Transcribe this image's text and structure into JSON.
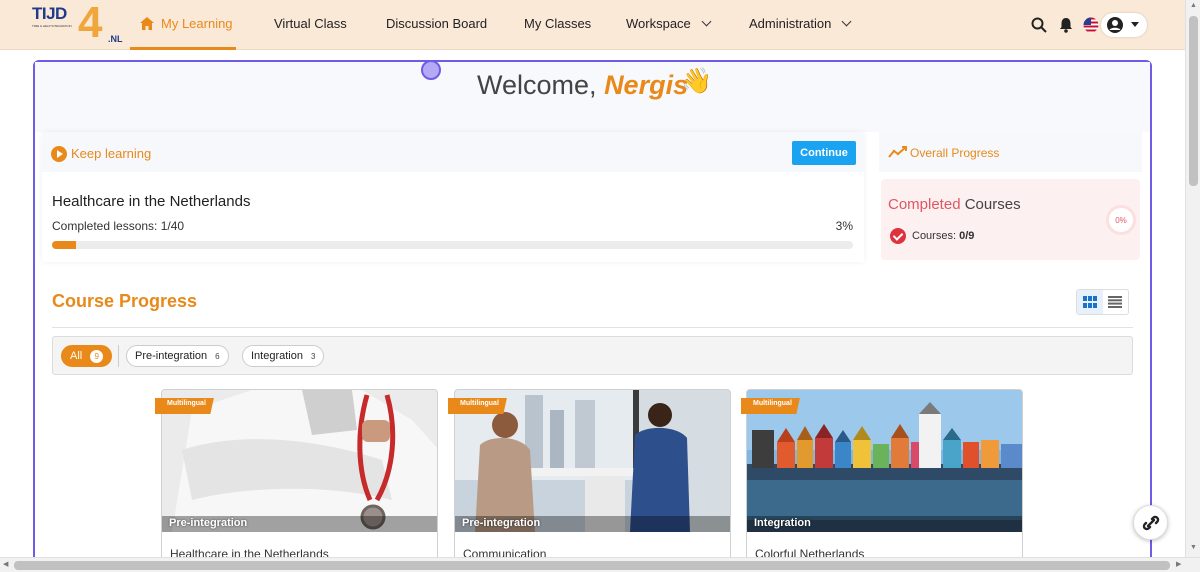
{
  "brand": {
    "logo_text": "TIJD",
    "logo_number": "4",
    "logo_suffix": ".NL",
    "tagline": "TIME & HELP INTEGRATION"
  },
  "nav": {
    "items": [
      {
        "label": "My Learning",
        "icon": "home-icon",
        "active": true
      },
      {
        "label": "Virtual Class"
      },
      {
        "label": "Discussion Board"
      },
      {
        "label": "My Classes"
      },
      {
        "label": "Workspace",
        "dropdown": true
      },
      {
        "label": "Administration",
        "dropdown": true
      }
    ],
    "icons": [
      "search-icon",
      "bell-icon",
      "us-flag-icon",
      "user-icon",
      "caret-down-icon"
    ]
  },
  "welcome": {
    "greeting": "Welcome,",
    "name": "Nergis",
    "emoji": "👋"
  },
  "keep_learning": {
    "label": "Keep learning",
    "button": "Continue",
    "course_title": "Healthcare in the Netherlands",
    "lessons_label": "Completed lessons: 1/40",
    "percent_label": "3%",
    "progress": 0.03
  },
  "overall": {
    "label": "Overall Progress",
    "completed_highlight": "Completed",
    "completed_rest": " Courses",
    "courses_label": "Courses:",
    "courses_value": "0/9",
    "ring_label": "0%"
  },
  "course_progress": {
    "title": "Course Progress",
    "filters": [
      {
        "label": "All",
        "count": "9",
        "active": true
      },
      {
        "label": "Pre-integration",
        "count": "6"
      },
      {
        "label": "Integration",
        "count": "3"
      }
    ],
    "cards": [
      {
        "badge": "Multilingual",
        "category": "Pre-integration",
        "title": "Healthcare in the Netherlands"
      },
      {
        "badge": "Multilingual",
        "category": "Pre-integration",
        "title": "Communication"
      },
      {
        "badge": "Multilingual",
        "category": "Integration",
        "title": "Colorful Netherlands"
      }
    ]
  },
  "colors": {
    "accent": "#e8891a",
    "primary": "#1aa3f0",
    "frame": "#6d5ce8",
    "danger": "#e05663"
  }
}
